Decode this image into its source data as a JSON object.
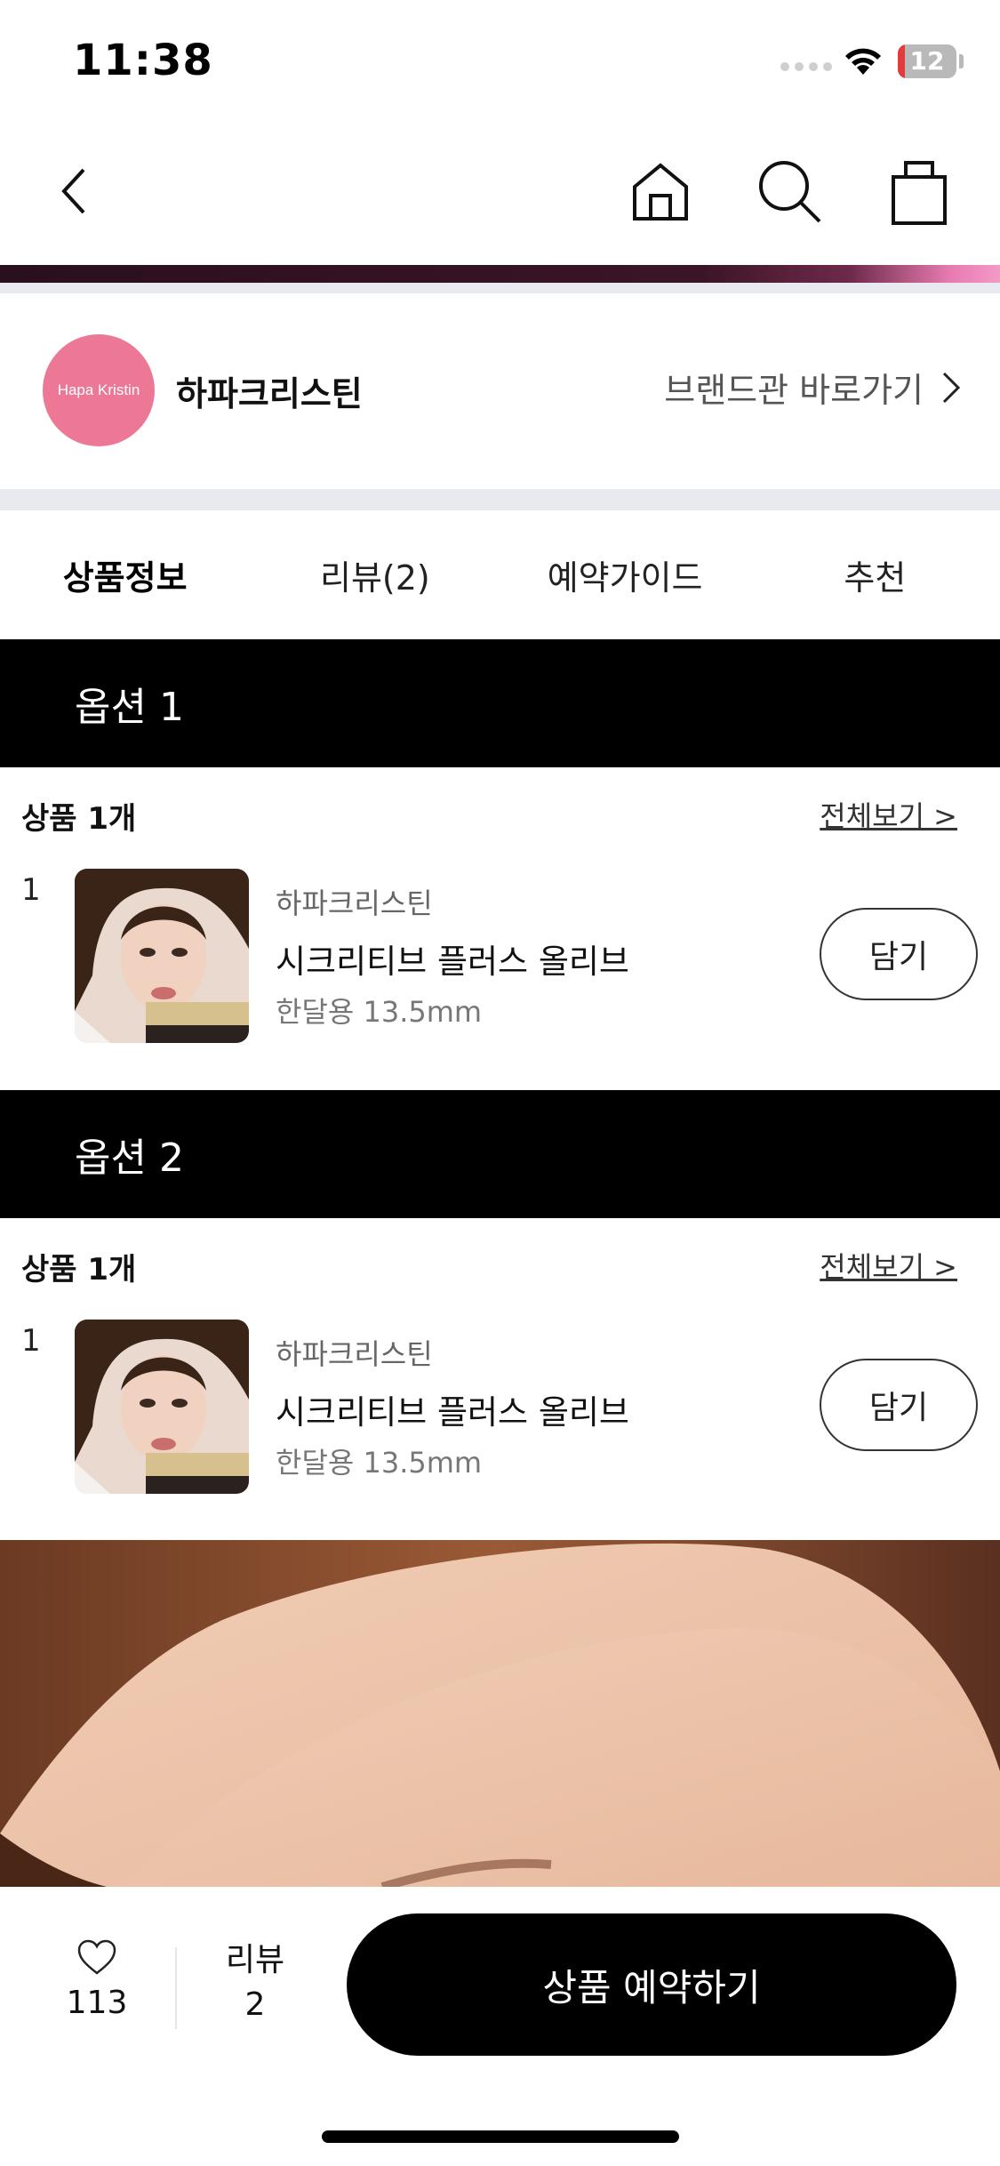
{
  "status_bar": {
    "time": "11:38",
    "battery": "12",
    "battery_fraction": 0.12
  },
  "brand": {
    "logo_text": "Hapa Kristin",
    "name": "하파크리스틴",
    "link_label": "브랜드관 바로가기"
  },
  "tabs": [
    {
      "label": "상품정보",
      "active": true
    },
    {
      "label": "리뷰(2)",
      "active": false
    },
    {
      "label": "예약가이드",
      "active": false
    },
    {
      "label": "추천",
      "active": false
    }
  ],
  "options": [
    {
      "title": "옵션 1",
      "count_label": "상품 1개",
      "view_all": "전체보기 >",
      "item": {
        "rank": "1",
        "brand": "하파크리스틴",
        "name": "시크리티브 플러스 올리브",
        "spec": "한달용 13.5mm",
        "add_label": "담기"
      }
    },
    {
      "title": "옵션 2",
      "count_label": "상품 1개",
      "view_all": "전체보기 >",
      "item": {
        "rank": "1",
        "brand": "하파크리스틴",
        "name": "시크리티브 플러스 올리브",
        "spec": "한달용 13.5mm",
        "add_label": "담기"
      }
    }
  ],
  "bottom_bar": {
    "likes": "113",
    "review_label": "리뷰",
    "review_count": "2",
    "reserve_label": "상품 예약하기"
  },
  "colors": {
    "brand_pink": "#ec7896",
    "black": "#000000",
    "divider": "#e9eaef"
  }
}
